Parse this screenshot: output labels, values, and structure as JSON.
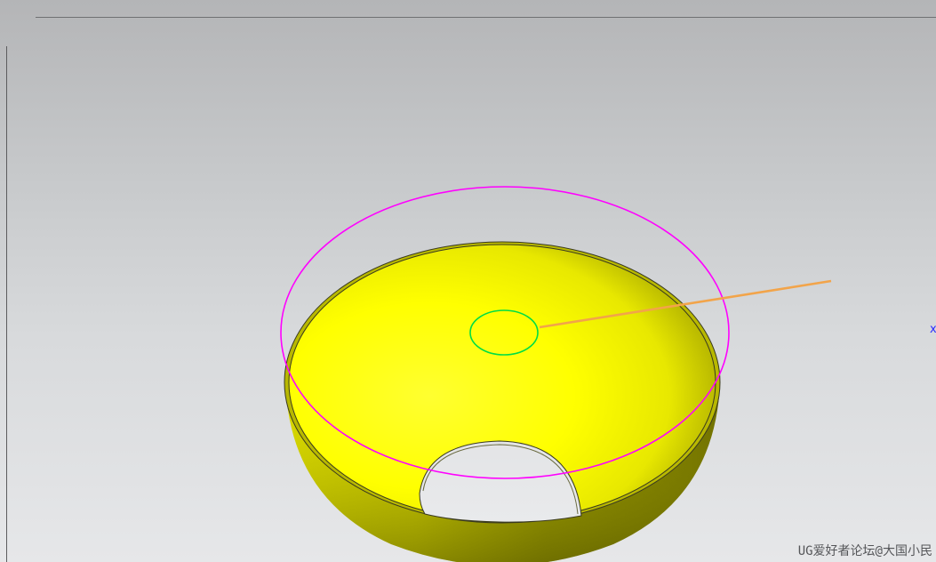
{
  "scene": {
    "model_color": "#ffff00",
    "model_shadow_color": "#6a6a00",
    "rim_edge_color": "#3a3a20",
    "outer_circle_color": "#ff00ff",
    "inner_circle_color": "#00dd44",
    "leader_line_color": "#f2a44a"
  },
  "axis_marker": {
    "label": "x",
    "color": "#2b2bff"
  },
  "watermark": {
    "text": "UG爱好者论坛@大国小民"
  }
}
